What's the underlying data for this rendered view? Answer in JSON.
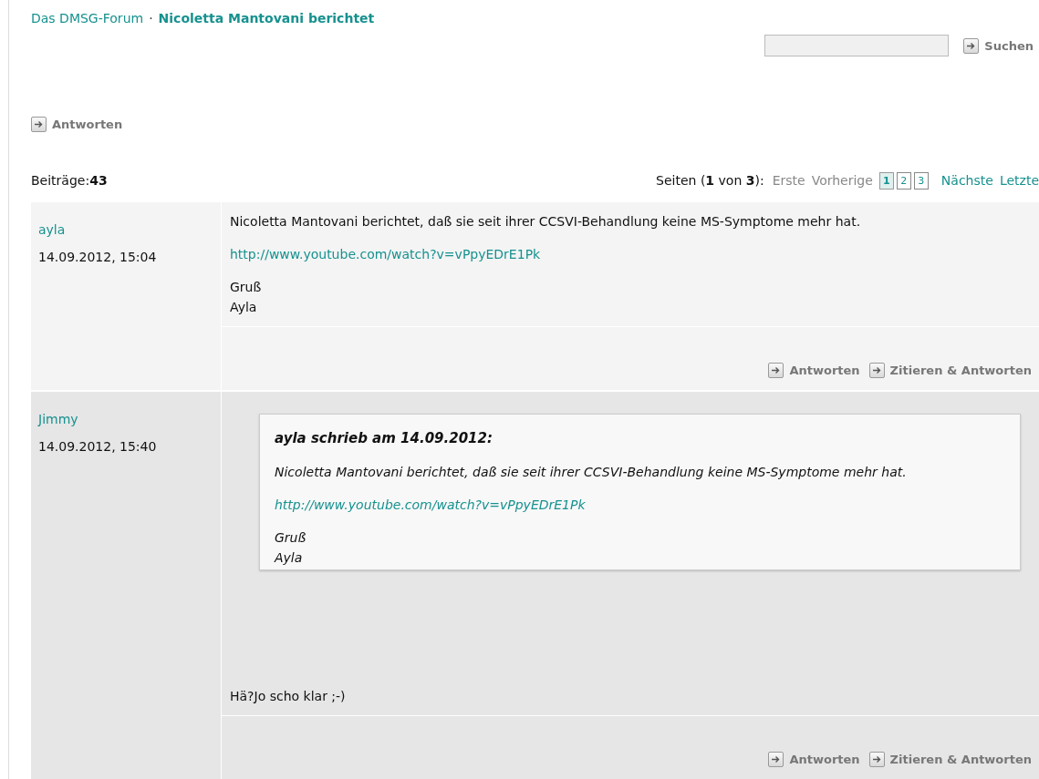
{
  "breadcrumb": {
    "parent": "Das DMSG-Forum",
    "separator": "·",
    "current": "Nicoletta Mantovani berichtet"
  },
  "search": {
    "button": "Suchen"
  },
  "reply_button": "Antworten",
  "post_count": {
    "label": "Beiträge:",
    "value": "43"
  },
  "pagination": {
    "label": "Seiten (**1** von **3**):",
    "before": [
      {
        "text": "Erste",
        "disabled": true
      },
      {
        "text": "Vorherige",
        "disabled": true
      }
    ],
    "pages": [
      {
        "text": "1",
        "selected": true
      },
      {
        "text": "2",
        "selected": false
      },
      {
        "text": "3",
        "selected": false
      }
    ],
    "after": [
      {
        "text": "Nächste",
        "disabled": false
      },
      {
        "text": "Letzte",
        "disabled": false
      }
    ]
  },
  "posts": [
    {
      "author": "ayla",
      "date": "14.09.2012, 15:04",
      "color": "#f4f4f4",
      "blocks": [
        {
          "kind": "text",
          "text": "Nicoletta Mantovani berichtet, daß sie seit ihrer CCSVI-Behandlung keine MS-Symptome mehr hat."
        },
        {
          "kind": "link",
          "text": "http://www.youtube.com/watch?v=vPpyEDrE1Pk"
        },
        {
          "kind": "lines",
          "lines": [
            "Gruß",
            "Ayla"
          ]
        }
      ],
      "actions": [
        "Antworten",
        "Zitieren & Antworten"
      ]
    },
    {
      "author": "Jimmy",
      "date": "14.09.2012, 15:40",
      "color": "#e6e6e6",
      "quote": {
        "header": "ayla schrieb am 14.09.2012:",
        "blocks": [
          {
            "kind": "text",
            "text": "Nicoletta Mantovani berichtet, daß sie seit ihrer CCSVI-Behandlung keine MS-Symptome mehr hat."
          },
          {
            "kind": "link",
            "text": "http://www.youtube.com/watch?v=vPpyEDrE1Pk"
          },
          {
            "kind": "lines",
            "lines": [
              "Gruß",
              "Ayla"
            ]
          }
        ]
      },
      "blocks": [
        {
          "kind": "text",
          "text": "Hä?Jo scho klar ;-)"
        }
      ],
      "actions": [
        "Antworten",
        "Zitieren & Antworten"
      ]
    }
  ]
}
